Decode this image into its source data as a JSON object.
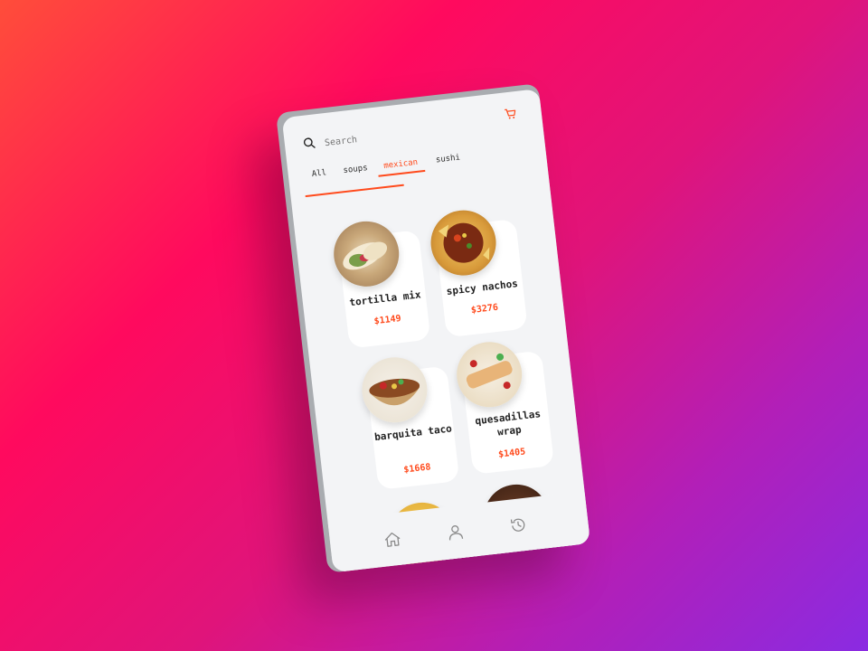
{
  "search": {
    "placeholder": "Search"
  },
  "tabs": [
    {
      "label": "All"
    },
    {
      "label": "soups"
    },
    {
      "label": "mexican"
    },
    {
      "label": "sushi"
    }
  ],
  "active_tab": "mexican",
  "products": [
    {
      "name": "tortilla mix",
      "price": "$1149"
    },
    {
      "name": "spicy nachos",
      "price": "$3276"
    },
    {
      "name": "barquita taco",
      "price": "$1668"
    },
    {
      "name": "quesadillas wrap",
      "price": "$1405"
    },
    {
      "name": "",
      "price": ""
    },
    {
      "name": "",
      "price": ""
    }
  ],
  "icons": {
    "search": "search-icon",
    "cart": "cart-icon",
    "home": "home-icon",
    "profile": "user-icon",
    "history": "history-icon"
  },
  "colors": {
    "accent": "#ff4a1c",
    "background": "#f3f4f6"
  }
}
